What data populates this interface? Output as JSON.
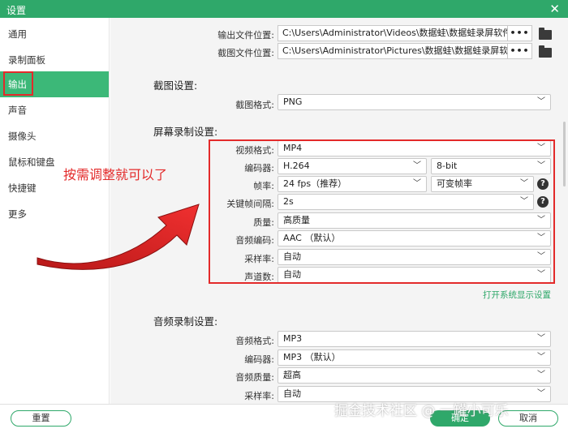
{
  "window": {
    "title": "设置",
    "close_glyph": "✕"
  },
  "sidebar": {
    "items": [
      {
        "label": "通用"
      },
      {
        "label": "录制面板"
      },
      {
        "label": "输出"
      },
      {
        "label": "声音"
      },
      {
        "label": "摄像头"
      },
      {
        "label": "鼠标和键盘"
      },
      {
        "label": "快捷键"
      },
      {
        "label": "更多"
      }
    ],
    "active": "输出"
  },
  "output": {
    "video_path_label": "输出文件位置:",
    "video_path": "C:\\Users\\Administrator\\Videos\\数据蛙\\数据蛙录屏软件",
    "screenshot_path_label": "截图文件位置:",
    "screenshot_path": "C:\\Users\\Administrator\\Pictures\\数据蛙\\数据蛙录屏软件",
    "more_glyph": "•••"
  },
  "screenshot": {
    "section_title": "截图设置:",
    "format_label": "截图格式:",
    "format_value": "PNG"
  },
  "screen": {
    "section_title": "屏幕录制设置:",
    "video_format_label": "视频格式:",
    "video_format_value": "MP4",
    "encoder_label": "编码器:",
    "encoder_value": "H.264",
    "bitdepth_value": "8-bit",
    "framerate_label": "帧率:",
    "framerate_value": "24 fps（推荐）",
    "framerate_mode_value": "可变帧率",
    "keyframe_label": "关键帧间隔:",
    "keyframe_value": "2s",
    "quality_label": "质量:",
    "quality_value": "高质量",
    "audio_codec_label": "音频编码:",
    "audio_codec_value": "AAC （默认）",
    "sample_rate_label": "采样率:",
    "sample_rate_value": "自动",
    "channels_label": "声道数:",
    "channels_value": "自动",
    "display_link": "打开系统显示设置"
  },
  "audio": {
    "section_title": "音频录制设置:",
    "format_label": "音频格式:",
    "format_value": "MP3",
    "encoder_label": "编码器:",
    "encoder_value": "MP3 （默认）",
    "quality_label": "音频质量:",
    "quality_value": "超高",
    "sample_rate_label": "采样率:",
    "sample_rate_value": "自动"
  },
  "annotation": {
    "text": "按需调整就可以了"
  },
  "footer": {
    "reset_label": "重置",
    "ok_label": "确定",
    "cancel_label": "取消"
  },
  "watermark": "掘金技术社区 @ 一罐小可乐",
  "colors": {
    "accent": "#2fa86a",
    "highlight": "#e32a2a"
  }
}
